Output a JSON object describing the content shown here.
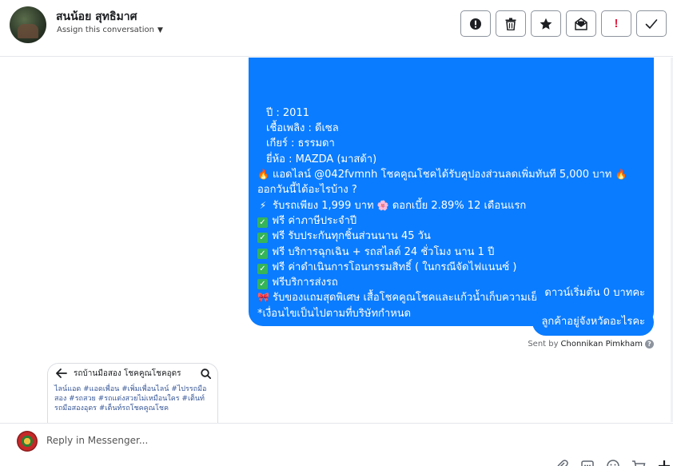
{
  "header": {
    "contact_name": "สนน้อย สุทธิมาศ",
    "assign_label": "Assign this conversation",
    "buttons": [
      {
        "name": "spam-button",
        "icon": "alert-circle-icon"
      },
      {
        "name": "delete-button",
        "icon": "trash-icon"
      },
      {
        "name": "star-button",
        "icon": "star-icon"
      },
      {
        "name": "mark-unread-button",
        "icon": "mail-open-icon"
      },
      {
        "name": "flag-button",
        "icon": "exclamation-icon",
        "label": "!"
      },
      {
        "name": "done-button",
        "icon": "check-icon"
      }
    ]
  },
  "messages": {
    "big_bubble": {
      "lines": [
        "ปี : 2011",
        "เชื้อเพลิง : ดีเซล",
        "เกียร์ : ธรรมดา",
        "ยี่ห้อ : MAZDA (มาสด้า)",
        "แอดไลน์ @042fvmnh โชคคูณโชคได้รับคูปองส่วนลดเพิ่มทันที 5,000 บาท",
        "ออกวันนี้ได้อะไรบ้าง ?",
        "รับรถเพียง 1,999 บาท",
        "ดอกเบี้ย 2.89% 12 เดือนแรก",
        "ฟรี ค่าภาษีประจำปี",
        "ฟรี รับประกันทุกชิ้นส่วนนาน 45 วัน",
        "ฟรี บริการฉุกเฉิน + รถสไลด์ 24 ชั่วโมง นาน 1 ปี",
        "ฟรี ค่าดำเนินการโอนกรรมสิทธิ์ ( ในกรณีจัดไฟแนนซ์ )",
        "ฟรีบริการส่งรถ",
        "รับของแถมสุดพิเศษ เสื้อโชคคูณโชคและแก้วน้ำเก็บความเย็น",
        "*เงื่อนไขเป็นไปตามที่บริษัทกำหนด"
      ]
    },
    "bubble_1": "ดาวน์เริ่มต้น 0 บาทคะ",
    "bubble_2": "ลูกค้าอยู่จังหวัดอะไรคะ",
    "sent_by_prefix": "Sent by",
    "sent_by_name": "Chonnikan Pimkham"
  },
  "preview_card": {
    "title": "รถบ้านมือสอง โชคคูณโชคอุดร",
    "tags": "ไลน์แอด #แอดเพื่อน #เพิ่มเพื่อนไลน์ #ไปรรถมือสอง #รถสวย #รถแต่งสวยไม่เหมือนใคร #เต็นท์รถมือสองอุดร #เต็นท์รถโชคคูณโชค"
  },
  "composer": {
    "placeholder": "Reply in Messenger..."
  },
  "colors": {
    "bubble_blue": "#0a7cff",
    "check_green": "#35b45a",
    "flag_red": "#e41e3f"
  }
}
